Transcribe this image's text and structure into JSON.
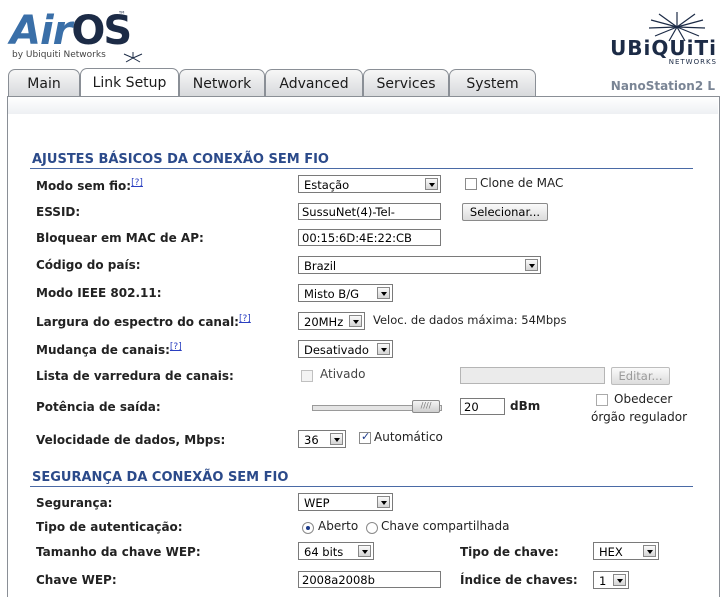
{
  "header": {
    "logo_air": "Air",
    "logo_os": "OS",
    "logo_tm": "™",
    "logo_sub": "by Ubiquiti Networks",
    "brand": "UBiQUiTi",
    "brand_sub": "NETWORKS",
    "device": "NanoStation2 L"
  },
  "tabs": [
    {
      "label": "Main"
    },
    {
      "label": "Link Setup",
      "active": true
    },
    {
      "label": "Network"
    },
    {
      "label": "Advanced"
    },
    {
      "label": "Services"
    },
    {
      "label": "System"
    }
  ],
  "basic": {
    "title": "AJUSTES BÁSICOS DA CONEXÃO SEM FIO",
    "help": "[?]",
    "wireless_mode": {
      "label": "Modo sem fio:",
      "value": "Estação",
      "clone_mac_label": "Clone de MAC"
    },
    "essid": {
      "label": "ESSID:",
      "value": "SussuNet(4)-Tel-",
      "select_button": "Selecionar..."
    },
    "lock_ap_mac": {
      "label": "Bloquear em MAC de AP:",
      "value": "00:15:6D:4E:22:CB"
    },
    "country": {
      "label": "Código do país:",
      "value": "Brazil"
    },
    "ieee_mode": {
      "label": "Modo IEEE 802.11:",
      "value": "Misto B/G"
    },
    "channel_width": {
      "label": "Largura do espectro do canal:",
      "value": "20MHz",
      "max_rate": "Veloc. de dados máxima: 54Mbps"
    },
    "channel_shifting": {
      "label": "Mudança de canais:",
      "value": "Desativado"
    },
    "scan_list": {
      "label": "Lista de varredura de canais:",
      "enabled_label": "Ativado",
      "edit_button": "Editar..."
    },
    "output_power": {
      "label": "Potência de saída:",
      "value": "20",
      "unit": "dBm",
      "obey_line1": "Obedecer",
      "obey_line2": "órgão regulador",
      "slider_level": 1.0
    },
    "data_rate": {
      "label": "Velocidade de dados, Mbps:",
      "value": "36",
      "auto_label": "Automático"
    }
  },
  "security": {
    "title": "SEGURANÇA DA CONEXÃO SEM FIO",
    "security": {
      "label": "Segurança:",
      "value": "WEP"
    },
    "auth_type": {
      "label": "Tipo de autenticação:",
      "open_label": "Aberto",
      "shared_label": "Chave compartilhada"
    },
    "wep_key_length": {
      "label": "Tamanho da chave WEP:",
      "value": "64 bits"
    },
    "key_type": {
      "label": "Tipo de chave:",
      "value": "HEX"
    },
    "wep_key": {
      "label": "Chave WEP:",
      "value": "2008a2008b"
    },
    "key_index": {
      "label": "Índice de chaves:",
      "value": "1"
    }
  },
  "colors": {
    "accent": "#2b4a8a",
    "brand": "#1c2b46",
    "logo_blue": "#3a6fa8"
  }
}
